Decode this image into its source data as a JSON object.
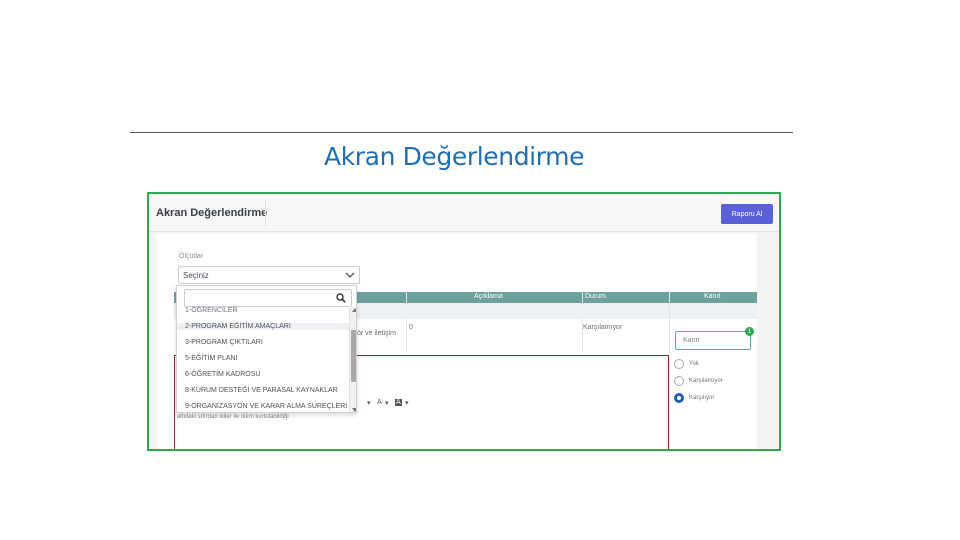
{
  "slide": {
    "title": "Akran Değerlendirme"
  },
  "app": {
    "title": "Akran Değerlendirme",
    "report_button": "Raporu Al"
  },
  "filter": {
    "label": "Ölçütlar",
    "selected": "Seçiniz",
    "search_placeholder": ""
  },
  "table": {
    "columns": [
      "Açıklama",
      "Durum",
      "Kanıt"
    ],
    "row": {
      "desc_fragment": "ör ve iletişim",
      "aciklama": "0",
      "durum": "Karşılamıyor"
    }
  },
  "dropdown_items": [
    "1-ÖĞRENCİLER",
    "2-PROGRAM EĞİTİM AMAÇLARI",
    "3-PROGRAM ÇIKTILARI",
    "5-EĞİTİM PLANI",
    "6-ÖĞRETİM KADROSU",
    "8-KURUM DESTEĞİ VE PARASAL KAYNAKLAR",
    "9-ORGANİZASYON VE KARAR ALMA SÜREÇLERİ"
  ],
  "editor": {
    "text": "altıdaki sıfırdan ikiler ile ıklım kurtulabildiği",
    "tools": [
      "▾",
      "A",
      "▾",
      "A",
      "▾"
    ]
  },
  "kanit": {
    "placeholder": "Kanıt",
    "badge": "1"
  },
  "radio_options": [
    {
      "label": "Yok",
      "selected": false
    },
    {
      "label": "Karşılamıyor",
      "selected": false
    },
    {
      "label": "Karşılıyor",
      "selected": true
    }
  ],
  "colors": {
    "accent": "#5b5fd8",
    "table_header": "#6ea09e",
    "frame_border": "#2fa84f",
    "title": "#1f6fb5"
  }
}
